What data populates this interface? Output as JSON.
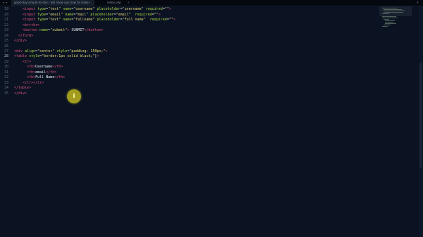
{
  "tabs": [
    {
      "label": "good-day-simple-to-dev | will show you how to make"
    },
    {
      "label": "index.php"
    }
  ],
  "tab_close_glyph": "×",
  "menu_glyph": "▾",
  "nav": {
    "left": "◂",
    "right": "▸"
  },
  "line_numbers": [
    "19",
    "20",
    "21",
    "22",
    "23",
    "24",
    "25",
    "26",
    "27",
    "28",
    "29",
    "30",
    "31",
    "32",
    "33",
    "34",
    "35"
  ],
  "active_line": "28",
  "code": {
    "l19": {
      "p0": "    <input ",
      "a0": "type",
      "p1": "=",
      "s0": "\"text\"",
      "a1": "name",
      "p2": "=",
      "s1": "\"username\"",
      "a2": "placeholder",
      "p3": "=",
      "s2": "\"username\"",
      "a3": "required",
      "p4": "=",
      "s3": "\"\"",
      "p5": ">"
    },
    "l20": {
      "p0": "    <input ",
      "a0": "type",
      "p1": "=",
      "s0": "\"email\"",
      "a1": "name",
      "p2": "=",
      "s1": "\"mail\"",
      "a2": "placeholder",
      "p3": "=",
      "s2": "\"email\"",
      "a3": "  required",
      "p4": "=",
      "s3": "\"\"",
      "p5": ">"
    },
    "l21": {
      "p0": "    <input ",
      "a0": "type",
      "p1": "=",
      "s0": "\"text\"",
      "a1": "name",
      "p2": "=",
      "s1": "\"fullname\"",
      "a2": "placeholder",
      "p3": "=",
      "s2": "\"Full name\"",
      "a3": "  required",
      "p4": "=",
      "s3": "\"\"",
      "p5": ">"
    },
    "l22": {
      "p0": "    <br><br>"
    },
    "l23": {
      "p0": "    <button ",
      "a0": "name",
      "p1": "=",
      "s0": "\"submit\"",
      "p2": "> ",
      "t0": "SUBMIT",
      "p3": "</button>"
    },
    "l24": {
      "p0": "  </form>"
    },
    "l25": {
      "p0": "</div>"
    },
    "l26": {
      "p0": ""
    },
    "l27": {
      "p0": "<div ",
      "a0": "align",
      "p1": "=",
      "s0": "\"center\"",
      "a1": "style",
      "p2": "=",
      "s1": "\"padding: 150px;\"",
      "p3": ">"
    },
    "l28": {
      "p0": "<table ",
      "a0": "style",
      "p1": "=",
      "s0": "\"border:1px solid black;\"",
      "c0": "|",
      "p2": ">"
    },
    "l29": {
      "p0": "    <tr>"
    },
    "l30": {
      "p0": "      <th>",
      "t0": "Username",
      "p1": "</th>"
    },
    "l31": {
      "p0": "      <th>",
      "t0": "email",
      "p1": "</th>"
    },
    "l32": {
      "p0": "      <th>",
      "t0": "Full Name",
      "p1": "</th>"
    },
    "l33": {
      "p0": "    </tr></tr>"
    },
    "l34": {
      "p0": "</table>"
    },
    "l35": {
      "p0": "</div>"
    }
  },
  "colors": {
    "background": "#0b1322",
    "tag": "#e0527e",
    "attribute": "#a6d43f",
    "string": "#e2d476",
    "click_marker": "#cdc41e"
  }
}
